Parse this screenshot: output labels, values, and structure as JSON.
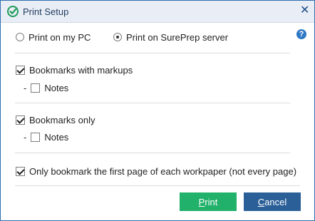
{
  "window": {
    "title": "Print Setup",
    "close_glyph": "✕",
    "help_glyph": "?"
  },
  "destination": {
    "options": [
      {
        "label": "Print on my PC",
        "selected": false
      },
      {
        "label": "Print on SurePrep server",
        "selected": true
      }
    ]
  },
  "options": {
    "bookmarks_with_markups": {
      "label": "Bookmarks with markups",
      "checked": true
    },
    "notes_1": {
      "prefix": "-",
      "label": "Notes",
      "checked": false
    },
    "bookmarks_only": {
      "label": "Bookmarks only",
      "checked": true
    },
    "notes_2": {
      "prefix": "-",
      "label": "Notes",
      "checked": false
    },
    "first_page_only": {
      "label": "Only bookmark the first page of each workpaper (not every page)",
      "checked": true
    }
  },
  "buttons": {
    "print": {
      "mnemonic": "P",
      "rest": "rint"
    },
    "cancel": {
      "mnemonic": "C",
      "rest": "ancel"
    }
  },
  "colors": {
    "print_button": "#21b16a",
    "cancel_button": "#2a5f98",
    "accent": "#2f78c4"
  },
  "icons": {
    "app": "green-check-circle-icon",
    "close": "close-icon",
    "help": "help-icon"
  }
}
